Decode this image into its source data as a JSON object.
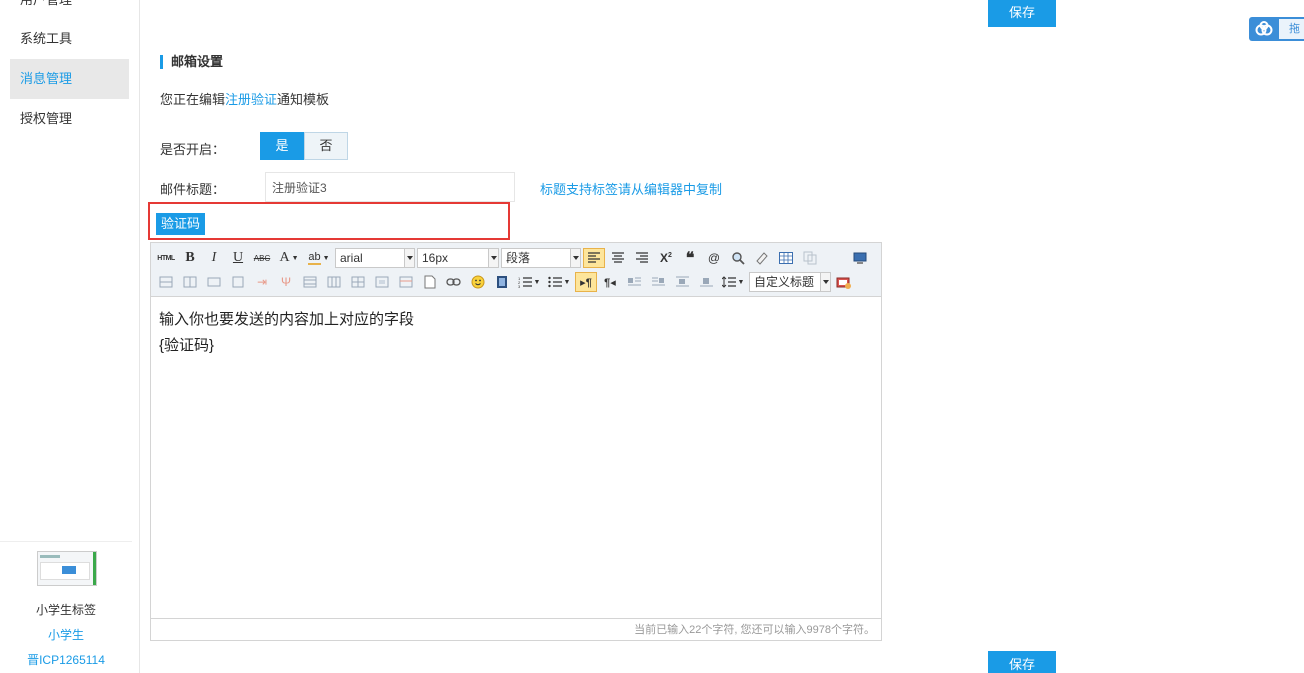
{
  "sidebar": {
    "items": [
      {
        "label": "用户管理"
      },
      {
        "label": "系统工具"
      },
      {
        "label": "消息管理",
        "active": true
      },
      {
        "label": "授权管理"
      }
    ],
    "footer": {
      "site_name": "小学生标签",
      "user": "小学生",
      "icp": "晋ICP1265114"
    }
  },
  "actions": {
    "save_top": "保存",
    "save_bottom": "保存"
  },
  "cloud_widget": {
    "icon": "cloud-icon",
    "label": "拖"
  },
  "section": {
    "title": "邮箱设置"
  },
  "edit_note": {
    "prefix": "您正在编辑",
    "link": "注册验证",
    "suffix": "通知模板"
  },
  "enable": {
    "label": "是否开启：",
    "yes": "是",
    "no": "否",
    "selected": "是"
  },
  "mail_title": {
    "label": "邮件标题：",
    "value": "注册验证3",
    "hint": "标题支持标签请从编辑器中复制"
  },
  "tags": [
    {
      "label": "验证码"
    }
  ],
  "editor": {
    "toolbar": {
      "font_family": "arial",
      "font_size": "16px",
      "paragraph": "段落",
      "custom_title": "自定义标题"
    },
    "content_lines": [
      "输入你也要发送的内容加上对应的字段",
      "{验证码}"
    ],
    "status": "当前已输入22个字符, 您还可以输入9978个字符。"
  },
  "colors": {
    "accent": "#1a9be6",
    "highlight_border": "#e53935"
  }
}
